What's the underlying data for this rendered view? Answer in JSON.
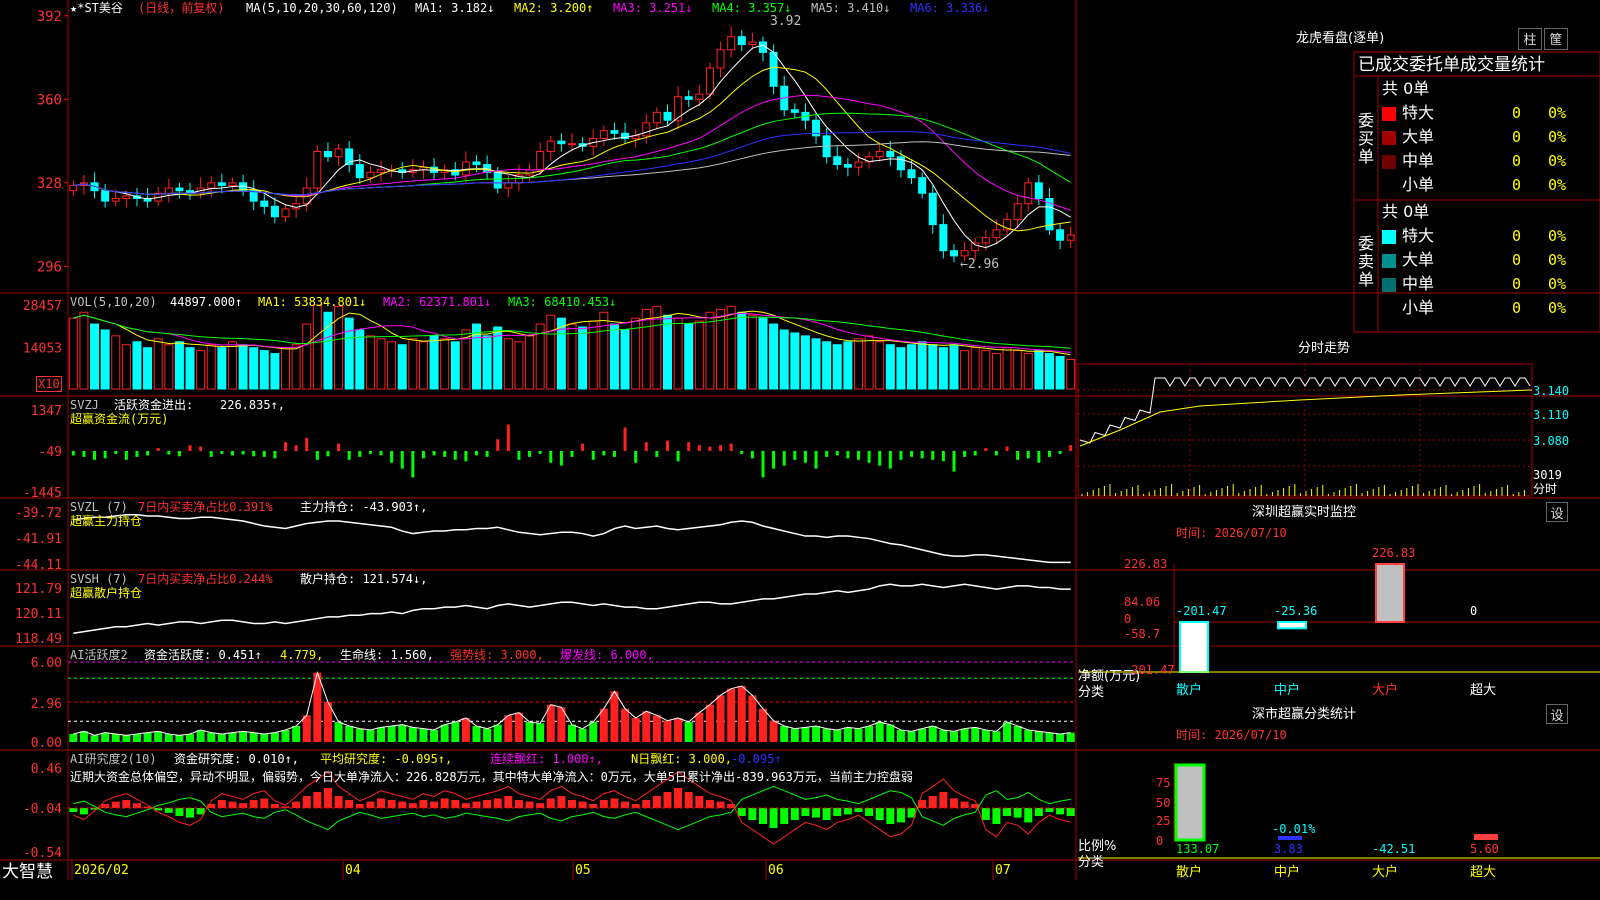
{
  "app": {
    "brand": "大智慧"
  },
  "main_chart": {
    "stock": "★*ST美谷",
    "period": "(日线，前复权)",
    "ma_label": "MA(5,10,20,30,60,120)",
    "ma": [
      {
        "name": "MA1:",
        "val": "3.182",
        "arrow": "↓",
        "color": "#ffffff"
      },
      {
        "name": "MA2:",
        "val": "3.200",
        "arrow": "↑",
        "color": "#ffff00"
      },
      {
        "name": "MA3:",
        "val": "3.251",
        "arrow": "↓",
        "color": "#ff00ff"
      },
      {
        "name": "MA4:",
        "val": "3.357",
        "arrow": "↓",
        "color": "#00ff00"
      },
      {
        "name": "MA5:",
        "val": "3.410",
        "arrow": "↓",
        "color": "#c0c0c0"
      },
      {
        "name": "MA6:",
        "val": "3.336",
        "arrow": "↓",
        "color": "#3030ff"
      }
    ],
    "y_ticks": [
      "392",
      "360",
      "328",
      "296"
    ],
    "high_label": "3.92",
    "low_label": "←2.96"
  },
  "vol_panel": {
    "label": "VOL(5,10,20)",
    "value": "44897.000",
    "arrow": "↑",
    "ma": [
      {
        "name": "MA1:",
        "val": "53834.801",
        "arrow": "↓",
        "color": "#ffff00"
      },
      {
        "name": "MA2:",
        "val": "62371.801",
        "arrow": "↓",
        "color": "#ff00ff"
      },
      {
        "name": "MA3:",
        "val": "68410.453",
        "arrow": "↓",
        "color": "#00ff00"
      }
    ],
    "y_ticks": [
      "28457",
      "14053"
    ],
    "unit": "X10"
  },
  "svzj_panel": {
    "label": "SVZJ",
    "desc": "活跃资金进出:",
    "value": "226.835",
    "arrow": "↑,",
    "sub": "超赢资金流(万元)",
    "y_ticks": [
      "1347",
      "-49",
      "-1445"
    ]
  },
  "svzl_panel": {
    "label": "SVZL (7)",
    "desc": "7日内买卖净占比0.391%",
    "desc2": "主力持仓:",
    "value": "-43.903",
    "arrow": "↑,",
    "sub": "超赢主力持仓",
    "y_ticks": [
      "-39.72",
      "-41.91",
      "-44.11"
    ]
  },
  "svsh_panel": {
    "label": "SVSH (7)",
    "desc": "7日内买卖净占比0.244%",
    "desc2": "散户持仓:",
    "value": "121.574",
    "arrow": "↓,",
    "sub": "超赢散户持仓",
    "y_ticks": [
      "121.79",
      "120.11",
      "118.49"
    ]
  },
  "ai1_panel": {
    "label": "AI活跃度2",
    "desc": "资金活跃度:",
    "value": "0.451",
    "arrow": "↑",
    "v2": "4.779,",
    "life": "生命线:",
    "life_val": "1.560,",
    "strong": "强势线:",
    "strong_val": "3.000,",
    "burst": "爆发线:",
    "burst_val": "6.000,",
    "y_ticks": [
      "6.00",
      "2.96",
      "0.00"
    ]
  },
  "ai2_panel": {
    "label": "AI研究度2(10)",
    "desc": "资金研究度:",
    "value": "0.010",
    "arrow": "↑,",
    "avg": "平均研究度:",
    "avg_val": "-0.095",
    "avg_arrow": "↑,",
    "red": "连续飘红:",
    "red_val": "1.000",
    "red_arrow": "↑,",
    "nred": "N日飘红:",
    "nred_val": "3.000,",
    "last": "-0.095",
    "last_arrow": "↑",
    "note": "近期大资金总体偏空，异动不明显，偏弱势，今日大单净流入：226.828万元，其中特大单净流入：0万元，大单5日累计净出-839.963万元，当前主力控盘弱",
    "y_ticks": [
      "0.46",
      "-0.04",
      "-0.54"
    ]
  },
  "x_axis": {
    "labels": [
      "2026/02",
      "04",
      "05",
      "06",
      "07"
    ]
  },
  "dragon": {
    "title": "龙虎看盘(逐单)",
    "btn1": "柱",
    "btn2": "筐",
    "header": "已成交委托单成交量统计",
    "buy": {
      "side": "委买单",
      "total": "共 0单",
      "rows": [
        {
          "name": "特大",
          "v": "0",
          "p": "0%",
          "color": "#ff0000"
        },
        {
          "name": "大单",
          "v": "0",
          "p": "0%",
          "color": "#a00000"
        },
        {
          "name": "中单",
          "v": "0",
          "p": "0%",
          "color": "#700000"
        },
        {
          "name": "小单",
          "v": "0",
          "p": "0%",
          "color": "#000000"
        }
      ]
    },
    "sell": {
      "side": "委卖单",
      "total": "共 0单",
      "rows": [
        {
          "name": "特大",
          "v": "0",
          "p": "0%",
          "color": "#00ffff"
        },
        {
          "name": "大单",
          "v": "0",
          "p": "0%",
          "color": "#009090"
        },
        {
          "name": "中单",
          "v": "0",
          "p": "0%",
          "color": "#007070"
        },
        {
          "name": "小单",
          "v": "0",
          "p": "0%",
          "color": "#000000"
        }
      ]
    }
  },
  "intraday": {
    "title": "分时走势",
    "y_ticks": [
      "3.140",
      "3.110",
      "3.080"
    ],
    "vol_val": "3019",
    "vol_unit": "分时"
  },
  "sz_monitor": {
    "title": "深圳超赢实时监控",
    "time": "时间: 2026/07/10",
    "btn": "设",
    "y_ticks": [
      "226.83",
      "84.06",
      "0",
      "-58.7",
      "-201.47"
    ],
    "bars": [
      {
        "label": "散户",
        "val": "-201.47",
        "v": -201.47
      },
      {
        "label": "中户",
        "val": "-25.36",
        "v": -25.36
      },
      {
        "label": "大户",
        "val": "226.83",
        "v": 226.83
      },
      {
        "label": "超大",
        "val": "0",
        "v": 0
      }
    ],
    "footer1": "净额(万元)",
    "footer2": "分类"
  },
  "sz_class": {
    "title": "深市超赢分类统计",
    "time": "时间: 2026/07/10",
    "btn": "设",
    "y_ticks": [
      "75",
      "50",
      "25",
      "0"
    ],
    "bars": [
      {
        "label": "散户",
        "val": "133.07",
        "v": 133.07,
        "color": "#00ff00"
      },
      {
        "label": "中户",
        "val": "3.83",
        "v": 3.83,
        "color": "#3030ff"
      },
      {
        "label": "大户",
        "val": "-42.51",
        "v": -42.51,
        "color": "#00ffff"
      },
      {
        "label": "超大",
        "val": "5.60",
        "v": 5.6,
        "color": "#ffff00"
      }
    ],
    "top_label": "-0.01%",
    "footer1": "比例%",
    "footer2": "分类"
  },
  "chart_data": {
    "type": "candlestick",
    "title": "★*ST美谷 (日线，前复权)",
    "x": [
      "2026/02",
      "04",
      "05",
      "06",
      "07"
    ],
    "ylim": [
      2.9,
      3.95
    ],
    "high": 3.92,
    "low": 2.96,
    "close": [
      3.27,
      3.28,
      3.25,
      3.21,
      3.22,
      3.23,
      3.22,
      3.21,
      3.24,
      3.26,
      3.25,
      3.24,
      3.26,
      3.28,
      3.27,
      3.28,
      3.25,
      3.21,
      3.19,
      3.15,
      3.18,
      3.2,
      3.26,
      3.4,
      3.38,
      3.41,
      3.35,
      3.3,
      3.32,
      3.33,
      3.33,
      3.32,
      3.33,
      3.34,
      3.32,
      3.33,
      3.31,
      3.36,
      3.35,
      3.32,
      3.26,
      3.28,
      3.31,
      3.33,
      3.4,
      3.44,
      3.43,
      3.43,
      3.42,
      3.45,
      3.48,
      3.47,
      3.45,
      3.46,
      3.51,
      3.55,
      3.52,
      3.61,
      3.6,
      3.62,
      3.72,
      3.79,
      3.84,
      3.81,
      3.82,
      3.78,
      3.65,
      3.56,
      3.55,
      3.52,
      3.46,
      3.38,
      3.35,
      3.34,
      3.36,
      3.38,
      3.4,
      3.38,
      3.33,
      3.3,
      3.24,
      3.12,
      3.02,
      3.0,
      3.02,
      3.05,
      3.07,
      3.1,
      3.14,
      3.2,
      3.28,
      3.22,
      3.1,
      3.06,
      3.08
    ]
  },
  "vol_data": {
    "values": [
      24000,
      26000,
      22000,
      20000,
      18000,
      15000,
      16000,
      14000,
      17000,
      15000,
      16000,
      14000,
      13000,
      15000,
      14000,
      16000,
      15000,
      14000,
      13000,
      12000,
      14000,
      15000,
      22000,
      28457,
      26000,
      28000,
      24000,
      20000,
      18000,
      17000,
      16000,
      15000,
      17000,
      16000,
      18000,
      17000,
      16000,
      20000,
      22000,
      18000,
      21000,
      17000,
      16000,
      18000,
      22000,
      25000,
      24000,
      22000,
      21000,
      23000,
      26000,
      22000,
      20000,
      24000,
      27000,
      28000,
      25000,
      24000,
      22000,
      23000,
      26000,
      27000,
      28000,
      26000,
      25000,
      24000,
      22000,
      20000,
      19000,
      18000,
      17000,
      16000,
      15000,
      16000,
      17000,
      18000,
      16000,
      15000,
      14000,
      15000,
      16000,
      15000,
      14000,
      15000,
      13000,
      14000,
      13000,
      12000,
      14000,
      13000,
      12000,
      13000,
      12000,
      11000,
      10000
    ]
  },
  "svzj_data": {
    "values": [
      -150,
      -200,
      -300,
      -250,
      -100,
      -300,
      -200,
      -150,
      100,
      -120,
      -180,
      200,
      150,
      -200,
      -100,
      -150,
      -120,
      -180,
      -200,
      -250,
      300,
      200,
      450,
      -300,
      -180,
      250,
      -300,
      -200,
      -100,
      -150,
      -400,
      -600,
      -900,
      -250,
      -150,
      -200,
      -300,
      -350,
      -150,
      -200,
      400,
      900,
      -300,
      -200,
      -100,
      -400,
      -500,
      -200,
      250,
      -300,
      -150,
      -200,
      800,
      -400,
      300,
      -200,
      350,
      -350,
      300,
      200,
      150,
      200,
      250,
      -100,
      -250,
      -900,
      -600,
      -500,
      -300,
      -400,
      -600,
      -200,
      -150,
      -250,
      -300,
      -400,
      -500,
      -600,
      -300,
      -200,
      -250,
      -300,
      -350,
      -700,
      -200,
      -150,
      100,
      -150,
      150,
      -300,
      -250,
      -400,
      -200,
      -100,
      200
    ]
  },
  "svzl_data": {
    "values": [
      -40.5,
      -40.4,
      -40.3,
      -40.3,
      -40.2,
      -40.1,
      -40.1,
      -40.2,
      -40.2,
      -40.3,
      -40.4,
      -40.4,
      -40.3,
      -40.3,
      -40.4,
      -40.5,
      -40.6,
      -40.8,
      -41.0,
      -41.1,
      -41.2,
      -41.0,
      -40.8,
      -40.7,
      -40.6,
      -40.6,
      -40.7,
      -40.8,
      -40.9,
      -41.0,
      -41.1,
      -41.4,
      -41.6,
      -41.5,
      -41.4,
      -41.4,
      -41.3,
      -41.3,
      -41.2,
      -41.2,
      -41.1,
      -41.3,
      -41.5,
      -41.6,
      -41.7,
      -41.6,
      -41.5,
      -41.5,
      -41.6,
      -41.8,
      -41.6,
      -41.2,
      -41.0,
      -41.2,
      -41.1,
      -41.0,
      -41.2,
      -41.3,
      -41.2,
      -41.1,
      -41.0,
      -40.9,
      -40.7,
      -40.6,
      -40.7,
      -41.0,
      -41.2,
      -41.4,
      -41.6,
      -41.8,
      -41.8,
      -41.9,
      -41.8,
      -41.8,
      -41.9,
      -42.0,
      -42.2,
      -42.4,
      -42.5,
      -42.7,
      -42.9,
      -43.1,
      -43.3,
      -43.4,
      -43.4,
      -43.3,
      -43.3,
      -43.4,
      -43.5,
      -43.6,
      -43.7,
      -43.8,
      -43.9,
      -43.9,
      -43.9
    ]
  },
  "svsh_data": {
    "values": [
      118.9,
      119.0,
      119.1,
      119.2,
      119.3,
      119.3,
      119.4,
      119.5,
      119.4,
      119.5,
      119.6,
      119.6,
      119.5,
      119.6,
      119.7,
      119.7,
      119.6,
      119.5,
      119.5,
      119.6,
      119.5,
      119.6,
      119.7,
      119.8,
      119.9,
      119.9,
      120.0,
      120.0,
      120.1,
      120.1,
      120.2,
      120.1,
      120.3,
      120.4,
      120.4,
      120.5,
      120.5,
      120.6,
      120.5,
      120.4,
      120.6,
      120.7,
      120.6,
      120.5,
      120.6,
      120.7,
      120.8,
      120.8,
      120.7,
      120.6,
      120.7,
      120.6,
      120.5,
      120.5,
      120.4,
      120.4,
      120.5,
      120.6,
      120.7,
      120.8,
      120.8,
      120.7,
      120.7,
      120.8,
      120.9,
      121.0,
      121.0,
      121.1,
      121.2,
      121.3,
      121.3,
      121.4,
      121.5,
      121.4,
      121.5,
      121.6,
      121.8,
      121.9,
      121.8,
      121.8,
      121.9,
      121.8,
      121.7,
      121.8,
      121.9,
      121.8,
      121.7,
      121.6,
      121.7,
      121.8,
      121.8,
      121.7,
      121.7,
      121.6,
      121.6
    ]
  },
  "ai1_data": {
    "values": [
      0.6,
      0.8,
      0.5,
      0.7,
      0.6,
      0.5,
      0.6,
      0.7,
      0.8,
      0.6,
      0.5,
      0.6,
      0.9,
      0.7,
      0.6,
      0.7,
      0.8,
      0.7,
      0.6,
      0.7,
      0.9,
      1.2,
      2.0,
      5.2,
      3.0,
      1.5,
      1.2,
      1.0,
      0.9,
      1.1,
      1.2,
      1.3,
      1.1,
      1.0,
      0.9,
      1.3,
      1.5,
      1.8,
      1.2,
      1.0,
      1.3,
      2.0,
      2.2,
      1.5,
      1.4,
      2.8,
      2.6,
      1.3,
      1.0,
      1.5,
      2.5,
      3.8,
      2.5,
      1.8,
      2.3,
      2.0,
      1.6,
      1.8,
      1.5,
      2.2,
      2.8,
      3.5,
      4.0,
      4.2,
      3.5,
      2.5,
      1.6,
      1.2,
      1.0,
      1.1,
      1.2,
      1.0,
      0.9,
      1.1,
      1.0,
      1.2,
      1.5,
      1.3,
      0.9,
      0.8,
      1.0,
      1.2,
      0.9,
      0.8,
      1.0,
      1.1,
      0.9,
      0.8,
      1.5,
      1.2,
      0.9,
      0.8,
      0.7,
      0.6,
      0.7
    ]
  },
  "ai2_data": {
    "values": [
      -0.05,
      -0.08,
      -0.02,
      0.05,
      0.08,
      0.1,
      0.06,
      0.02,
      -0.03,
      -0.06,
      -0.1,
      -0.12,
      -0.08,
      0.05,
      0.1,
      0.08,
      0.06,
      0.1,
      0.12,
      0.05,
      0.02,
      0.08,
      0.15,
      0.2,
      0.25,
      0.15,
      0.1,
      0.05,
      0.08,
      0.12,
      0.1,
      0.08,
      0.06,
      0.1,
      0.08,
      0.12,
      0.1,
      0.06,
      0.08,
      0.1,
      0.12,
      0.15,
      0.1,
      0.08,
      0.06,
      0.12,
      0.15,
      0.1,
      0.08,
      0.05,
      0.1,
      0.12,
      0.08,
      0.05,
      0.1,
      0.15,
      0.2,
      0.25,
      0.2,
      0.15,
      0.1,
      0.08,
      0.05,
      -0.1,
      -0.15,
      -0.2,
      -0.25,
      -0.2,
      -0.15,
      -0.1,
      -0.12,
      -0.15,
      -0.1,
      -0.08,
      -0.05,
      -0.1,
      -0.15,
      -0.2,
      -0.18,
      -0.12,
      0.1,
      0.15,
      0.2,
      0.12,
      0.08,
      0.05,
      -0.15,
      -0.2,
      -0.1,
      -0.12,
      -0.18,
      -0.1,
      -0.05,
      -0.08,
      -0.1
    ]
  }
}
